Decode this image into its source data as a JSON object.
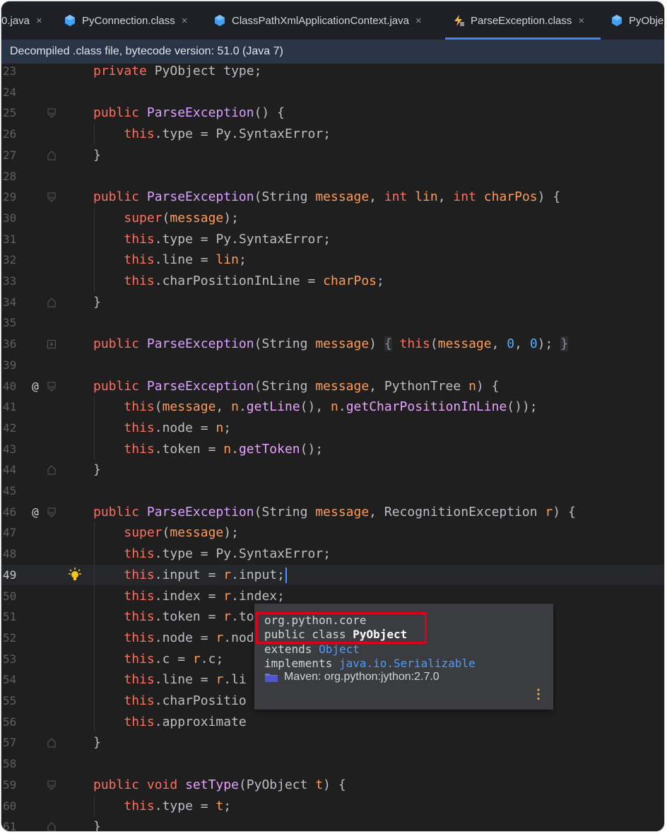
{
  "tabs": [
    {
      "label": "0.java",
      "icon": "none",
      "close": "×",
      "active": false
    },
    {
      "label": "PyConnection.class",
      "icon": "class-icon",
      "close": "×",
      "active": false
    },
    {
      "label": "ClassPathXmlApplicationContext.java",
      "icon": "class-icon",
      "close": "×",
      "active": false
    },
    {
      "label": "ParseException.class",
      "icon": "exception-class-icon",
      "close": "×",
      "active": true
    },
    {
      "label": "PyObje",
      "icon": "class-icon",
      "close": "",
      "active": false
    }
  ],
  "banner": {
    "text": "Decompiled .class file, bytecode version: 51.0 (Java 7)"
  },
  "colors": {
    "accent": "#3f83f0",
    "banner_bg": "#2a3447",
    "editor_bg": "#1f1f1f",
    "keyword": "#ff6e5e",
    "method": "#e8a2ff",
    "param": "#ff9b54",
    "number": "#4ab0ff",
    "highlight_box": "#e0001a"
  },
  "kinds": {
    "k": "keyword",
    "t": "type",
    "f": "method",
    "c": "constructor",
    "d": "field",
    "p": "parameter",
    "n": "number",
    "o": "plain",
    "z": "folded"
  },
  "lines": [
    {
      "n": "23",
      "tokens": [
        [
          "k",
          "private"
        ],
        [
          "o",
          " "
        ],
        [
          "t",
          "PyObject"
        ],
        [
          "o",
          " "
        ],
        [
          "d",
          "type"
        ],
        [
          "o",
          ";"
        ]
      ]
    },
    {
      "n": "24",
      "tokens": []
    },
    {
      "n": "25",
      "fold": "open",
      "tokens": [
        [
          "k",
          "public"
        ],
        [
          "o",
          " "
        ],
        [
          "c",
          "ParseException"
        ],
        [
          "o",
          "() {"
        ]
      ]
    },
    {
      "n": "26",
      "tokens": [
        [
          "o",
          "    "
        ],
        [
          "k",
          "this"
        ],
        [
          "o",
          "."
        ],
        [
          "d",
          "type"
        ],
        [
          "o",
          " = "
        ],
        [
          "t",
          "Py"
        ],
        [
          "o",
          "."
        ],
        [
          "d",
          "SyntaxError"
        ],
        [
          "o",
          ";"
        ]
      ]
    },
    {
      "n": "27",
      "fold": "close",
      "tokens": [
        [
          "o",
          "}"
        ]
      ]
    },
    {
      "n": "28",
      "tokens": []
    },
    {
      "n": "29",
      "fold": "open",
      "tokens": [
        [
          "k",
          "public"
        ],
        [
          "o",
          " "
        ],
        [
          "c",
          "ParseException"
        ],
        [
          "o",
          "("
        ],
        [
          "t",
          "String"
        ],
        [
          "o",
          " "
        ],
        [
          "p",
          "message"
        ],
        [
          "o",
          ", "
        ],
        [
          "k",
          "int"
        ],
        [
          "o",
          " "
        ],
        [
          "p",
          "lin"
        ],
        [
          "o",
          ", "
        ],
        [
          "k",
          "int"
        ],
        [
          "o",
          " "
        ],
        [
          "p",
          "charPos"
        ],
        [
          "o",
          ") {"
        ]
      ]
    },
    {
      "n": "30",
      "tokens": [
        [
          "o",
          "    "
        ],
        [
          "k",
          "super"
        ],
        [
          "o",
          "("
        ],
        [
          "p",
          "message"
        ],
        [
          "o",
          ");"
        ]
      ]
    },
    {
      "n": "31",
      "tokens": [
        [
          "o",
          "    "
        ],
        [
          "k",
          "this"
        ],
        [
          "o",
          "."
        ],
        [
          "d",
          "type"
        ],
        [
          "o",
          " = "
        ],
        [
          "t",
          "Py"
        ],
        [
          "o",
          "."
        ],
        [
          "d",
          "SyntaxError"
        ],
        [
          "o",
          ";"
        ]
      ]
    },
    {
      "n": "32",
      "tokens": [
        [
          "o",
          "    "
        ],
        [
          "k",
          "this"
        ],
        [
          "o",
          "."
        ],
        [
          "d",
          "line"
        ],
        [
          "o",
          " = "
        ],
        [
          "p",
          "lin"
        ],
        [
          "o",
          ";"
        ]
      ]
    },
    {
      "n": "33",
      "tokens": [
        [
          "o",
          "    "
        ],
        [
          "k",
          "this"
        ],
        [
          "o",
          "."
        ],
        [
          "d",
          "charPositionInLine"
        ],
        [
          "o",
          " = "
        ],
        [
          "p",
          "charPos"
        ],
        [
          "o",
          ";"
        ]
      ]
    },
    {
      "n": "34",
      "fold": "close",
      "tokens": [
        [
          "o",
          "}"
        ]
      ]
    },
    {
      "n": "35",
      "tokens": []
    },
    {
      "n": "36",
      "fold": "plus",
      "tokens": [
        [
          "k",
          "public"
        ],
        [
          "o",
          " "
        ],
        [
          "c",
          "ParseException"
        ],
        [
          "o",
          "("
        ],
        [
          "t",
          "String"
        ],
        [
          "o",
          " "
        ],
        [
          "p",
          "message"
        ],
        [
          "o",
          ")"
        ],
        [
          "o",
          " "
        ],
        [
          "z",
          "{"
        ],
        [
          "o",
          " "
        ],
        [
          "k",
          "this"
        ],
        [
          "o",
          "("
        ],
        [
          "p",
          "message"
        ],
        [
          "o",
          ", "
        ],
        [
          "n",
          "0"
        ],
        [
          "o",
          ", "
        ],
        [
          "n",
          "0"
        ],
        [
          "o",
          ");"
        ],
        [
          "o",
          " "
        ],
        [
          "z",
          "}"
        ]
      ]
    },
    {
      "n": "39",
      "tokens": []
    },
    {
      "n": "40",
      "mark": "@",
      "fold": "open",
      "tokens": [
        [
          "k",
          "public"
        ],
        [
          "o",
          " "
        ],
        [
          "c",
          "ParseException"
        ],
        [
          "o",
          "("
        ],
        [
          "t",
          "String"
        ],
        [
          "o",
          " "
        ],
        [
          "p",
          "message"
        ],
        [
          "o",
          ", "
        ],
        [
          "t",
          "PythonTree"
        ],
        [
          "o",
          " "
        ],
        [
          "p",
          "n"
        ],
        [
          "o",
          ") {"
        ]
      ]
    },
    {
      "n": "41",
      "tokens": [
        [
          "o",
          "    "
        ],
        [
          "k",
          "this"
        ],
        [
          "o",
          "("
        ],
        [
          "p",
          "message"
        ],
        [
          "o",
          ", "
        ],
        [
          "p",
          "n"
        ],
        [
          "o",
          "."
        ],
        [
          "f",
          "getLine"
        ],
        [
          "o",
          "(), "
        ],
        [
          "p",
          "n"
        ],
        [
          "o",
          "."
        ],
        [
          "f",
          "getCharPositionInLine"
        ],
        [
          "o",
          "());"
        ]
      ]
    },
    {
      "n": "42",
      "tokens": [
        [
          "o",
          "    "
        ],
        [
          "k",
          "this"
        ],
        [
          "o",
          "."
        ],
        [
          "d",
          "node"
        ],
        [
          "o",
          " = "
        ],
        [
          "p",
          "n"
        ],
        [
          "o",
          ";"
        ]
      ]
    },
    {
      "n": "43",
      "tokens": [
        [
          "o",
          "    "
        ],
        [
          "k",
          "this"
        ],
        [
          "o",
          "."
        ],
        [
          "d",
          "token"
        ],
        [
          "o",
          " = "
        ],
        [
          "p",
          "n"
        ],
        [
          "o",
          "."
        ],
        [
          "f",
          "getToken"
        ],
        [
          "o",
          "();"
        ]
      ]
    },
    {
      "n": "44",
      "fold": "close",
      "tokens": [
        [
          "o",
          "}"
        ]
      ]
    },
    {
      "n": "45",
      "tokens": []
    },
    {
      "n": "46",
      "mark": "@",
      "fold": "open",
      "tokens": [
        [
          "k",
          "public"
        ],
        [
          "o",
          " "
        ],
        [
          "c",
          "ParseException"
        ],
        [
          "o",
          "("
        ],
        [
          "t",
          "String"
        ],
        [
          "o",
          " "
        ],
        [
          "p",
          "message"
        ],
        [
          "o",
          ", "
        ],
        [
          "t",
          "RecognitionException"
        ],
        [
          "o",
          " "
        ],
        [
          "p",
          "r"
        ],
        [
          "o",
          ") {"
        ]
      ]
    },
    {
      "n": "47",
      "tokens": [
        [
          "o",
          "    "
        ],
        [
          "k",
          "super"
        ],
        [
          "o",
          "("
        ],
        [
          "p",
          "message"
        ],
        [
          "o",
          ");"
        ]
      ]
    },
    {
      "n": "48",
      "tokens": [
        [
          "o",
          "    "
        ],
        [
          "k",
          "this"
        ],
        [
          "o",
          "."
        ],
        [
          "d",
          "type"
        ],
        [
          "o",
          " = "
        ],
        [
          "t",
          "Py"
        ],
        [
          "o",
          "."
        ],
        [
          "d",
          "SyntaxError"
        ],
        [
          "o",
          ";"
        ]
      ]
    },
    {
      "n": "49",
      "current": true,
      "bulb": true,
      "caret": true,
      "tokens": [
        [
          "o",
          "    "
        ],
        [
          "k",
          "this"
        ],
        [
          "o",
          "."
        ],
        [
          "d",
          "input"
        ],
        [
          "o",
          " = "
        ],
        [
          "p",
          "r"
        ],
        [
          "o",
          "."
        ],
        [
          "d",
          "input"
        ],
        [
          "o",
          ";"
        ]
      ]
    },
    {
      "n": "50",
      "tokens": [
        [
          "o",
          "    "
        ],
        [
          "k",
          "this"
        ],
        [
          "o",
          "."
        ],
        [
          "d",
          "index"
        ],
        [
          "o",
          " = "
        ],
        [
          "p",
          "r"
        ],
        [
          "o",
          "."
        ],
        [
          "d",
          "index"
        ],
        [
          "o",
          ";"
        ]
      ]
    },
    {
      "n": "51",
      "tokens": [
        [
          "o",
          "    "
        ],
        [
          "k",
          "this"
        ],
        [
          "o",
          "."
        ],
        [
          "d",
          "token"
        ],
        [
          "o",
          " = "
        ],
        [
          "p",
          "r"
        ],
        [
          "o",
          "."
        ],
        [
          "d",
          "token"
        ],
        [
          "o",
          ";"
        ]
      ]
    },
    {
      "n": "52",
      "tokens": [
        [
          "o",
          "    "
        ],
        [
          "k",
          "this"
        ],
        [
          "o",
          "."
        ],
        [
          "d",
          "node"
        ],
        [
          "o",
          " = "
        ],
        [
          "p",
          "r"
        ],
        [
          "o",
          "."
        ],
        [
          "d",
          "node"
        ],
        [
          "o",
          ";"
        ]
      ]
    },
    {
      "n": "53",
      "tokens": [
        [
          "o",
          "    "
        ],
        [
          "k",
          "this"
        ],
        [
          "o",
          "."
        ],
        [
          "d",
          "c"
        ],
        [
          "o",
          " = "
        ],
        [
          "p",
          "r"
        ],
        [
          "o",
          "."
        ],
        [
          "d",
          "c"
        ],
        [
          "o",
          ";"
        ]
      ]
    },
    {
      "n": "54",
      "tokens": [
        [
          "o",
          "    "
        ],
        [
          "k",
          "this"
        ],
        [
          "o",
          "."
        ],
        [
          "d",
          "line"
        ],
        [
          "o",
          " = "
        ],
        [
          "p",
          "r"
        ],
        [
          "o",
          "."
        ],
        [
          "d",
          "li"
        ]
      ]
    },
    {
      "n": "55",
      "tokens": [
        [
          "o",
          "    "
        ],
        [
          "k",
          "this"
        ],
        [
          "o",
          "."
        ],
        [
          "d",
          "charPositio"
        ]
      ]
    },
    {
      "n": "56",
      "tokens": [
        [
          "o",
          "    "
        ],
        [
          "k",
          "this"
        ],
        [
          "o",
          "."
        ],
        [
          "d",
          "approximate"
        ]
      ]
    },
    {
      "n": "57",
      "fold": "close",
      "tokens": [
        [
          "o",
          "}"
        ]
      ]
    },
    {
      "n": "58",
      "tokens": []
    },
    {
      "n": "59",
      "fold": "open",
      "tokens": [
        [
          "k",
          "public"
        ],
        [
          "o",
          " "
        ],
        [
          "k",
          "void"
        ],
        [
          "o",
          " "
        ],
        [
          "f",
          "setType"
        ],
        [
          "o",
          "("
        ],
        [
          "t",
          "PyObject"
        ],
        [
          "o",
          " "
        ],
        [
          "p",
          "t"
        ],
        [
          "o",
          ") {"
        ]
      ]
    },
    {
      "n": "60",
      "tokens": [
        [
          "o",
          "    "
        ],
        [
          "k",
          "this"
        ],
        [
          "o",
          "."
        ],
        [
          "d",
          "type"
        ],
        [
          "o",
          " = "
        ],
        [
          "p",
          "t"
        ],
        [
          "o",
          ";"
        ]
      ]
    },
    {
      "n": "61",
      "fold": "close",
      "tokens": [
        [
          "o",
          "}"
        ]
      ]
    }
  ],
  "popup": {
    "package": "org.python.core",
    "decl_prefix": "public class ",
    "decl_name": "PyObject",
    "extends_prefix": "extends ",
    "extends_name": "Object",
    "implements_prefix": "implements ",
    "implements_name": "java.io.Serializable",
    "library": "Maven: org.python:jython:2.7.0",
    "more": "⋮"
  }
}
